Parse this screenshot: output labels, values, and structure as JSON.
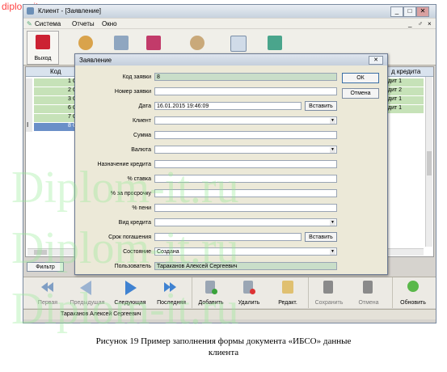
{
  "watermark": {
    "top": "diplom-it.ru",
    "big": [
      "Diplom-it.ru",
      "Diplom-it.ru",
      "Diplom-it.ru"
    ]
  },
  "window": {
    "title": "Клиент - [Заявление]",
    "controls": [
      "_",
      "□",
      "✕"
    ]
  },
  "menu": {
    "items": [
      "Система",
      "Отчеты",
      "Окно"
    ],
    "right_controls": [
      "_",
      "♂",
      "×"
    ]
  },
  "toolbar": {
    "exit_label": "Выход"
  },
  "grid": {
    "col_code": "Код",
    "col_credit": "д кредита",
    "rows": [
      {
        "code": "1",
        "tail": "С",
        "credit": "дит 1"
      },
      {
        "code": "2",
        "tail": "С",
        "credit": "дит 2"
      },
      {
        "code": "3",
        "tail": "С",
        "credit": "дит 1"
      },
      {
        "code": "6",
        "tail": "С",
        "credit": "дит 1"
      },
      {
        "code": "7",
        "tail": "С",
        "credit": ""
      },
      {
        "code": "8",
        "tail": "С",
        "credit": ""
      }
    ],
    "row_marker": "I"
  },
  "dialog": {
    "title": "Заявление",
    "close": "✕",
    "ok": "ОК",
    "cancel": "Отмена",
    "insert": "Вставить",
    "fields": {
      "code": {
        "label": "Код заявки",
        "value": "8"
      },
      "number": {
        "label": "Номер заявки",
        "value": ""
      },
      "date": {
        "label": "Дата",
        "value": "16.01.2015 19:46:09"
      },
      "client": {
        "label": "Клиент",
        "value": ""
      },
      "sum": {
        "label": "Сумма",
        "value": ""
      },
      "currency": {
        "label": "Валюта",
        "value": ""
      },
      "purpose": {
        "label": "Назначение кредита",
        "value": ""
      },
      "rate": {
        "label": "% ставка",
        "value": ""
      },
      "overdue": {
        "label": "% за просрочку",
        "value": ""
      },
      "penalty": {
        "label": "% пени",
        "value": ""
      },
      "kind": {
        "label": "Вид кредита",
        "value": ""
      },
      "term": {
        "label": "Срок погашения",
        "value": ""
      },
      "state": {
        "label": "Состояние",
        "value": "Создана"
      },
      "user": {
        "label": "Пользователь",
        "value": "Тараканов Алексей Сергеевич"
      }
    }
  },
  "filter_label": "Фильтр",
  "nav": {
    "first": "Первая",
    "prev": "Предыдущая",
    "next": "Следующая",
    "last": "Последняя",
    "add": "Добавить",
    "delete": "Удалить",
    "edit": "Редакт.",
    "save": "Сохранить",
    "cancel": "Отмена",
    "refresh": "Обновить"
  },
  "status": {
    "user": "Тараканов Алексей Сергеевич"
  },
  "caption": {
    "line1": "Рисунок 19 Пример заполнения формы документа «ИБСО» данные",
    "line2": "клиента"
  },
  "colors": {
    "selected_row": "#6a8fc8",
    "readonly_field": "#c9dec9",
    "grid_row": "#c6e2b8"
  }
}
